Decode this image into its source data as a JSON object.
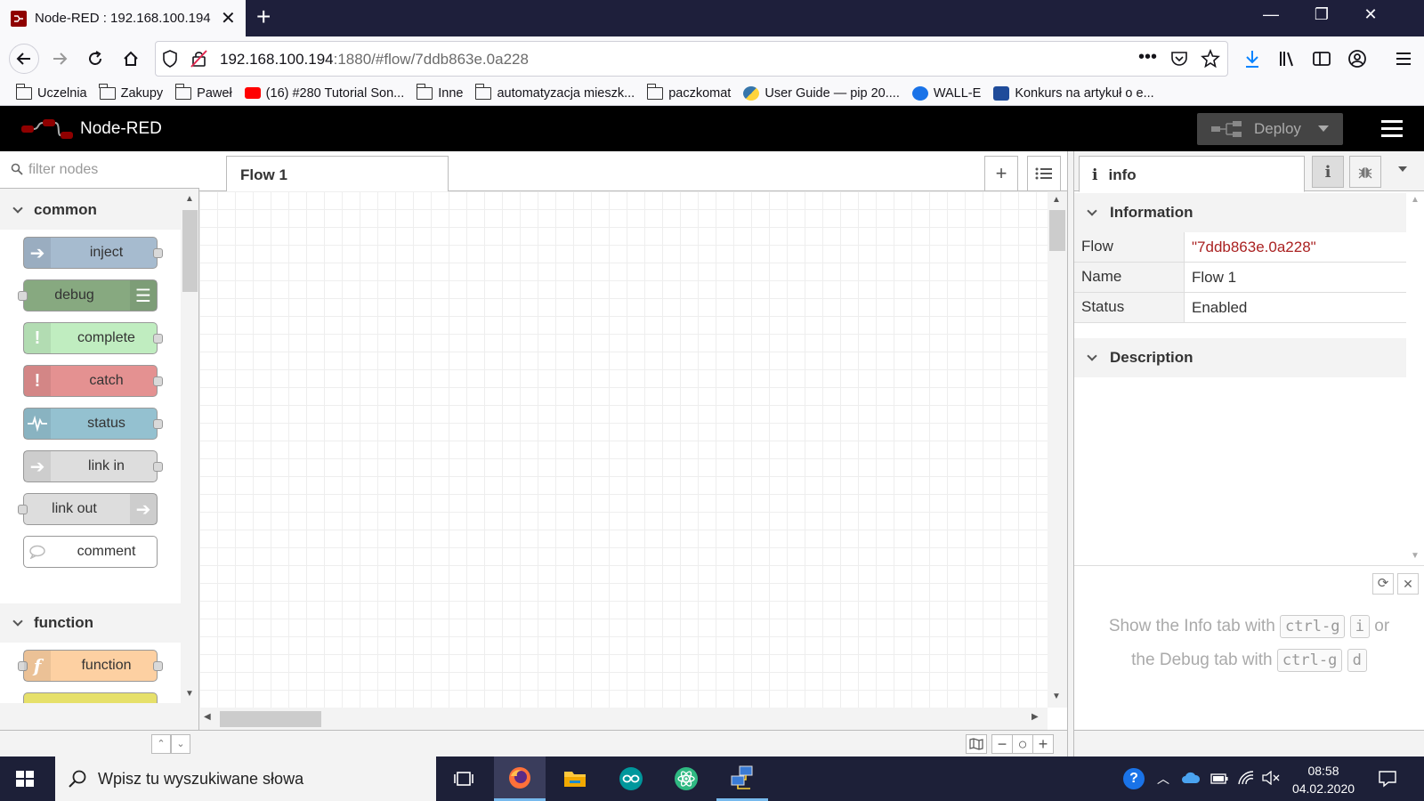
{
  "browser": {
    "tab_title": "Node-RED : 192.168.100.194",
    "url_host": "192.168.100.194",
    "url_rest": ":1880/#flow/7ddb863e.0a228",
    "bookmarks": [
      {
        "label": "Uczelnia",
        "type": "folder"
      },
      {
        "label": "Zakupy",
        "type": "folder"
      },
      {
        "label": "Paweł",
        "type": "folder"
      },
      {
        "label": "(16) #280 Tutorial Son...",
        "type": "youtube"
      },
      {
        "label": "Inne",
        "type": "folder"
      },
      {
        "label": "automatyzacja mieszk...",
        "type": "folder"
      },
      {
        "label": "paczkomat",
        "type": "folder"
      },
      {
        "label": "User Guide — pip 20....",
        "type": "python"
      },
      {
        "label": "WALL-E",
        "type": "site"
      },
      {
        "label": "Konkurs na artykuł o e...",
        "type": "site"
      }
    ]
  },
  "nodered": {
    "app_title": "Node-RED",
    "deploy_label": "Deploy",
    "palette": {
      "filter_placeholder": "filter nodes",
      "categories": [
        {
          "label": "common"
        },
        {
          "label": "function"
        }
      ],
      "nodes": [
        {
          "label": "inject",
          "color": "#a6bbcf"
        },
        {
          "label": "debug",
          "color": "#87a980"
        },
        {
          "label": "complete",
          "color": "#c0edc0"
        },
        {
          "label": "catch",
          "color": "#e49191"
        },
        {
          "label": "status",
          "color": "#94c1d0"
        },
        {
          "label": "link in",
          "color": "#dddddd"
        },
        {
          "label": "link out",
          "color": "#dddddd"
        },
        {
          "label": "comment",
          "color": "#ffffff"
        },
        {
          "label": "function",
          "color": "#fdd0a2"
        }
      ]
    },
    "workspace": {
      "flow_tab": "Flow 1"
    },
    "sidebar": {
      "tab_label": "info",
      "sections": {
        "information": "Information",
        "description": "Description"
      },
      "rows": [
        {
          "key": "Flow",
          "value": "\"7ddb863e.0a228\""
        },
        {
          "key": "Name",
          "value": "Flow 1"
        },
        {
          "key": "Status",
          "value": "Enabled"
        }
      ],
      "tips": {
        "line1_a": "Show the Info tab with",
        "line1_k1": "ctrl-g",
        "line1_k2": "i",
        "line1_b": "or",
        "line2_a": "the Debug tab with",
        "line2_k1": "ctrl-g",
        "line2_k2": "d"
      }
    }
  },
  "taskbar": {
    "search_placeholder": "Wpisz tu wyszukiwane słowa",
    "time": "08:58",
    "date": "04.02.2020"
  },
  "colors": {
    "flow_id_value": "#aa2222",
    "header_bg": "#000000",
    "taskbar_bg": "#1d2038"
  }
}
